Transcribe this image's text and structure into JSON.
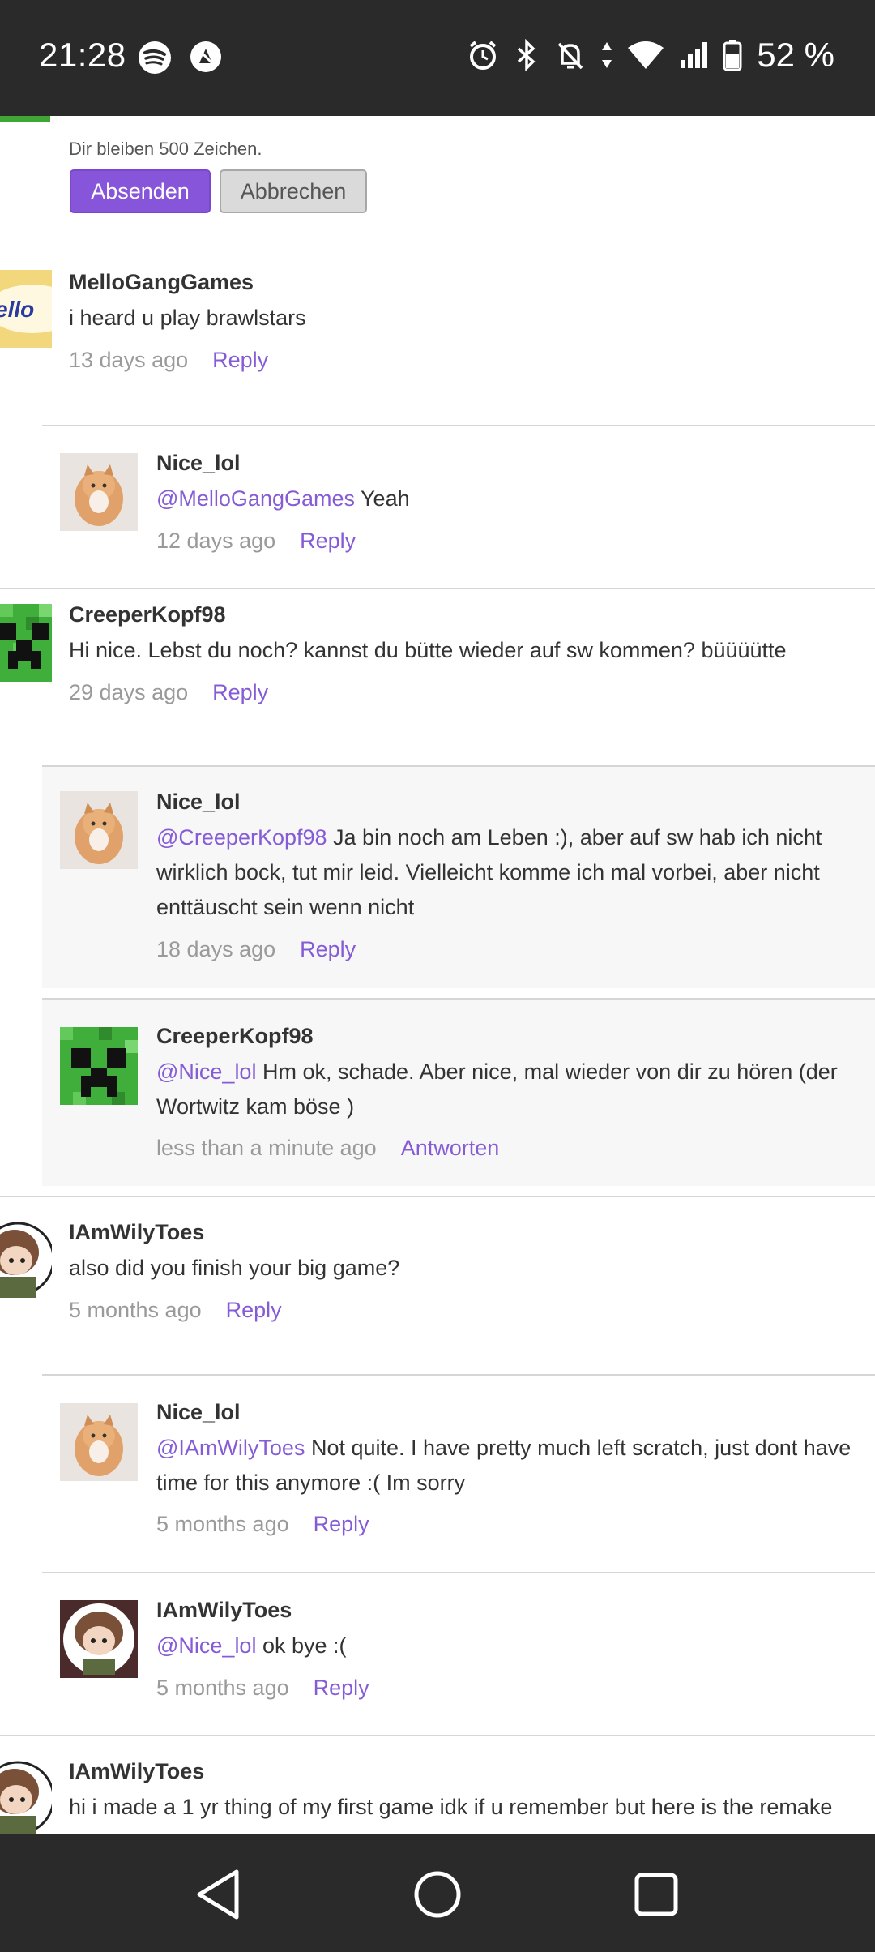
{
  "status": {
    "time": "21:28",
    "battery": "52 %"
  },
  "compose": {
    "remaining": "Dir bleiben 500 Zeichen.",
    "send_label": "Absenden",
    "cancel_label": "Abbrechen"
  },
  "comments": [
    {
      "user": "MelloGangGames",
      "mention": "",
      "text": "i heard u play brawlstars",
      "time": "13 days ago",
      "reply": "Reply",
      "avatar": "mello-logo"
    },
    {
      "user": "Nice_lol",
      "mention": "@MelloGangGames",
      "text": " Yeah",
      "time": "12 days ago",
      "reply": "Reply",
      "avatar": "cat-photo"
    },
    {
      "user": "CreeperKopf98",
      "mention": "",
      "text": "Hi nice. Lebst du noch? kannst du bütte wieder auf sw kommen? büüüütte",
      "time": "29 days ago",
      "reply": "Reply",
      "avatar": "creeper"
    },
    {
      "user": "Nice_lol",
      "mention": "@CreeperKopf98",
      "text": " Ja bin noch am Leben :), aber auf sw hab ich nicht wirklich bock, tut mir leid. Vielleicht komme ich mal vorbei, aber nicht enttäuscht sein wenn nicht",
      "time": "18 days ago",
      "reply": "Reply",
      "avatar": "cat-photo"
    },
    {
      "user": "CreeperKopf98",
      "mention": "@Nice_lol",
      "text": " Hm ok, schade. Aber nice, mal wieder von dir zu hören (der Wortwitz kam böse )",
      "time": "less than a minute ago",
      "reply": "Antworten",
      "avatar": "creeper"
    },
    {
      "user": "IAmWilyToes",
      "mention": "",
      "text": "also did you finish your big game?",
      "time": "5 months ago",
      "reply": "Reply",
      "avatar": "anime-girl"
    },
    {
      "user": "Nice_lol",
      "mention": "@IAmWilyToes",
      "text": " Not quite. I have pretty much left scratch, just dont have time for this anymore :( Im sorry",
      "time": "5 months ago",
      "reply": "Reply",
      "avatar": "cat-photo"
    },
    {
      "user": "IAmWilyToes",
      "mention": "@Nice_lol",
      "text": " ok bye :(",
      "time": "5 months ago",
      "reply": "Reply",
      "avatar": "anime-girl"
    },
    {
      "user": "IAmWilyToes",
      "mention": "",
      "text": "hi i made a 1 yr thing of my first game idk if u remember but here is the remake",
      "time": "",
      "reply": "",
      "avatar": "anime-girl"
    }
  ],
  "colors": {
    "accent": "#855cd6",
    "button": "#8755d9",
    "bars": "#2a2a2a"
  }
}
